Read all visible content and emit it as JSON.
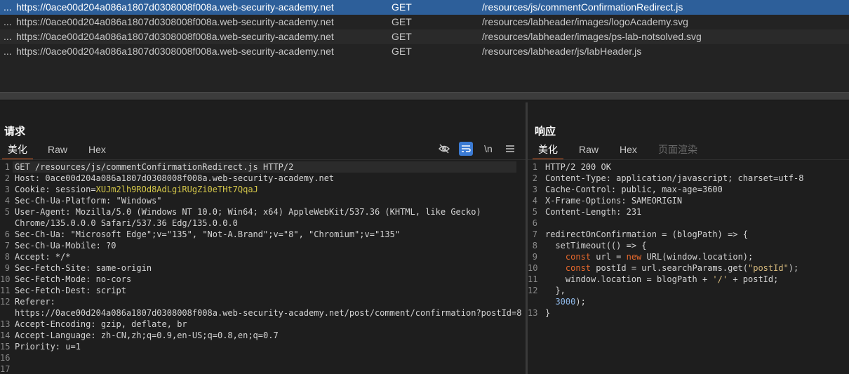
{
  "history": {
    "rows": [
      {
        "dots": "...",
        "host": "https://0ace00d204a086a1807d0308008f008a.web-security-academy.net",
        "method": "GET",
        "url": "/resources/js/commentConfirmationRedirect.js",
        "selected": true
      },
      {
        "dots": "...",
        "host": "https://0ace00d204a086a1807d0308008f008a.web-security-academy.net",
        "method": "GET",
        "url": "/resources/labheader/images/logoAcademy.svg",
        "selected": false
      },
      {
        "dots": "...",
        "host": "https://0ace00d204a086a1807d0308008f008a.web-security-academy.net",
        "method": "GET",
        "url": "/resources/labheader/images/ps-lab-notsolved.svg",
        "selected": false
      },
      {
        "dots": "...",
        "host": "https://0ace00d204a086a1807d0308008f008a.web-security-academy.net",
        "method": "GET",
        "url": "/resources/labheader/js/labHeader.js",
        "selected": false
      }
    ]
  },
  "request": {
    "title": "请求",
    "tabs": {
      "pretty": "美化",
      "raw": "Raw",
      "hex": "Hex"
    },
    "toolbar": {
      "hide_icon": "eye-off-icon",
      "wrap_icon": "wrap-icon",
      "newline_label": "\\n",
      "menu_icon": "menu-icon"
    },
    "lines": [
      {
        "n": "1",
        "text": "GET /resources/js/commentConfirmationRedirect.js HTTP/2"
      },
      {
        "n": "2",
        "k": "Host:",
        "v": " 0ace00d204a086a1807d0308008f008a.web-security-academy.net"
      },
      {
        "n": "3",
        "k": "Cookie:",
        "ck": " session=",
        "cv": "XUJm2lh9ROd8AdLgiRUgZi0eTHt7QqaJ"
      },
      {
        "n": "4",
        "k": "Sec-Ch-Ua-Platform:",
        "v": " \"Windows\""
      },
      {
        "n": "5",
        "k": "User-Agent:",
        "v": " Mozilla/5.0 (Windows NT 10.0; Win64; x64) AppleWebKit/537.36 (KHTML, like Gecko)"
      },
      {
        "n": "",
        "v": "Chrome/135.0.0.0 Safari/537.36 Edg/135.0.0.0"
      },
      {
        "n": "6",
        "k": "Sec-Ch-Ua:",
        "v": " \"Microsoft Edge\";v=\"135\", \"Not-A.Brand\";v=\"8\", \"Chromium\";v=\"135\""
      },
      {
        "n": "7",
        "k": "Sec-Ch-Ua-Mobile:",
        "v": " ?0"
      },
      {
        "n": "8",
        "k": "Accept:",
        "v": " */*"
      },
      {
        "n": "9",
        "k": "Sec-Fetch-Site:",
        "v": " same-origin"
      },
      {
        "n": "10",
        "k": "Sec-Fetch-Mode:",
        "v": " no-cors"
      },
      {
        "n": "11",
        "k": "Sec-Fetch-Dest:",
        "v": " script"
      },
      {
        "n": "12",
        "k": "Referer:",
        "v": ""
      },
      {
        "n": "",
        "v": "https://0ace00d204a086a1807d0308008f008a.web-security-academy.net/post/comment/confirmation?postId=8"
      },
      {
        "n": "13",
        "k": "Accept-Encoding:",
        "v": " gzip, deflate, br"
      },
      {
        "n": "14",
        "k": "Accept-Language:",
        "v": " zh-CN,zh;q=0.9,en-US;q=0.8,en;q=0.7"
      },
      {
        "n": "15",
        "k": "Priority:",
        "v": " u=1"
      },
      {
        "n": "16",
        "v": ""
      },
      {
        "n": "17",
        "v": ""
      }
    ]
  },
  "response": {
    "title": "响应",
    "tabs": {
      "pretty": "美化",
      "raw": "Raw",
      "hex": "Hex",
      "render": "页面渲染"
    },
    "lines": [
      {
        "n": "1",
        "text": "HTTP/2 200 OK"
      },
      {
        "n": "2",
        "k": "Content-Type:",
        "v": " application/javascript; charset=utf-8"
      },
      {
        "n": "3",
        "k": "Cache-Control:",
        "v": " public, max-age=3600"
      },
      {
        "n": "4",
        "k": "X-Frame-Options:",
        "v": " SAMEORIGIN"
      },
      {
        "n": "5",
        "k": "Content-Length:",
        "v": " 231"
      },
      {
        "n": "6",
        "v": ""
      },
      {
        "n": "7",
        "v": "redirectOnConfirmation = (blogPath) => {"
      },
      {
        "n": "8",
        "v": "  setTimeout(() => {"
      },
      {
        "n": "9",
        "kw": "    const",
        "v": " url = ",
        "kw2": "new",
        "v2": " URL(window.location);"
      },
      {
        "n": "10",
        "kw": "    const",
        "v": " postId = url.searchParams.get(",
        "str": "\"postId\"",
        "v2": ");"
      },
      {
        "n": "11",
        "v": "    window.location = blogPath + ",
        "str": "'/'",
        "v2": " + postId;"
      },
      {
        "n": "12",
        "v": "  },"
      },
      {
        "n": "",
        "num": "  3000",
        "v2": ");"
      },
      {
        "n": "13",
        "v": "}"
      }
    ]
  }
}
